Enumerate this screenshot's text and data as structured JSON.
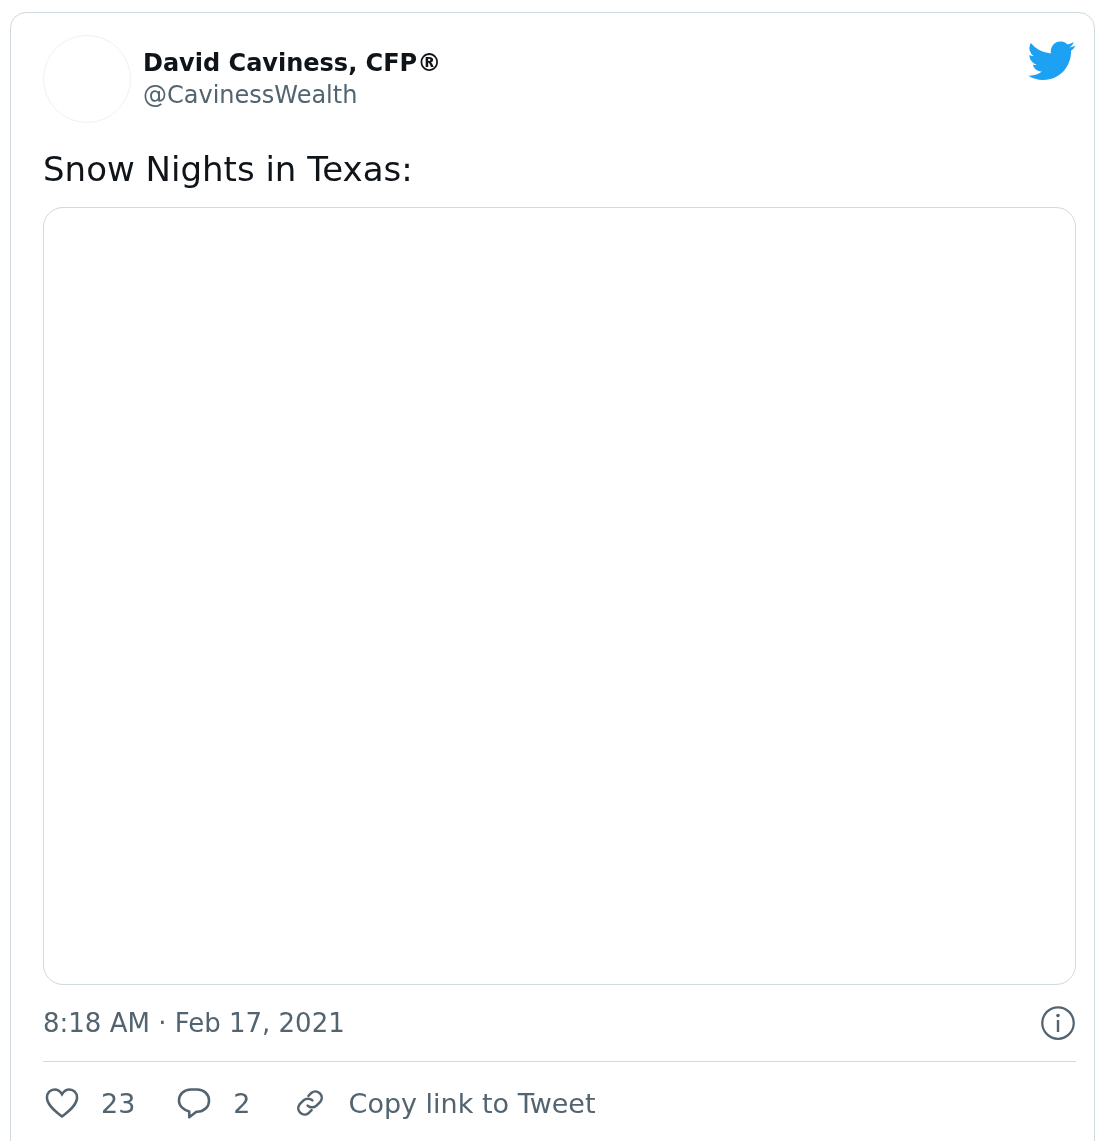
{
  "author": {
    "name": "David Caviness, CFP®",
    "handle": "@CavinessWealth"
  },
  "tweet": {
    "text": "Snow Nights in Texas:"
  },
  "timestamp": "8:18 AM · Feb 17, 2021",
  "actions": [
    {
      "kind": "like",
      "label": "23"
    },
    {
      "kind": "reply",
      "label": "2"
    },
    {
      "kind": "copy-link",
      "label": "Copy link to Tweet"
    }
  ]
}
